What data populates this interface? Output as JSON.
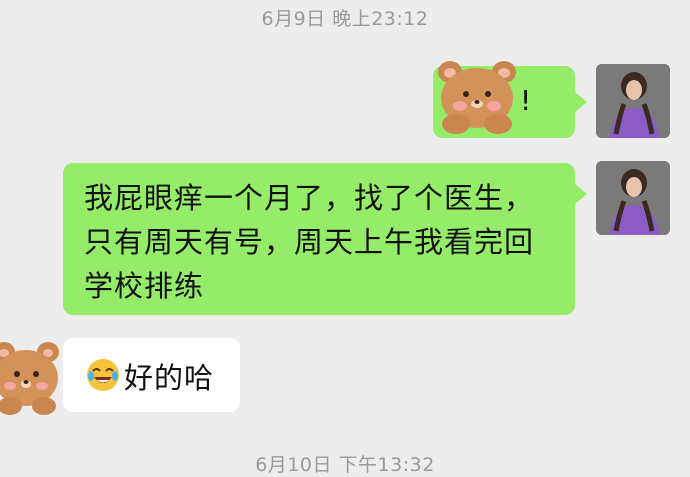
{
  "chat": {
    "timestamp_top": "6月9日 晚上23:12",
    "timestamp_bottom": "6月10日 下午13:32",
    "messages": [
      {
        "side": "right",
        "type": "sticker",
        "text": "!",
        "sticker": "bear-sticker"
      },
      {
        "side": "right",
        "type": "text",
        "lines": [
          "我屁眼痒一个月了，找了个医生，",
          "只有周天有号，周天上午我看完回",
          "学校排练"
        ]
      },
      {
        "side": "left",
        "type": "text",
        "emoji": "crying-laughing-emoji",
        "text": "好的哈"
      }
    ]
  },
  "colors": {
    "background": "#ededed",
    "outgoing_bubble": "#95ec69",
    "incoming_bubble": "#ffffff"
  }
}
